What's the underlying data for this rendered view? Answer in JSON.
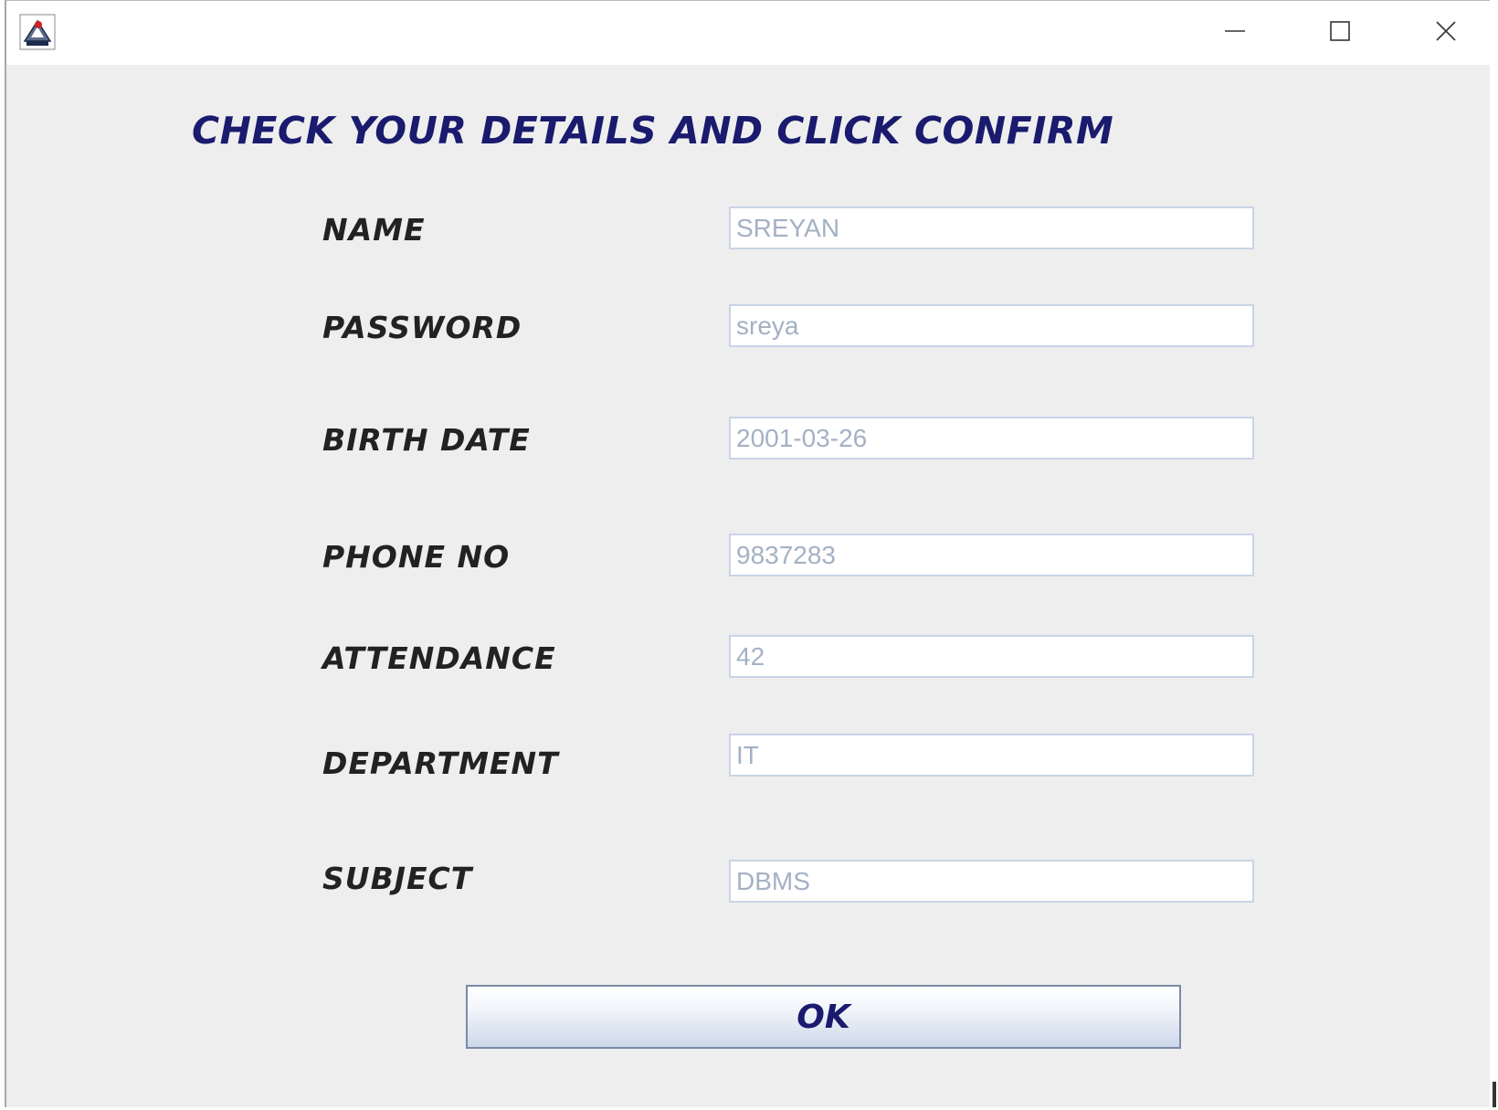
{
  "window": {
    "app_icon": "java-cup-icon",
    "controls": {
      "minimize_icon": "minimize-icon",
      "maximize_icon": "maximize-icon",
      "close_icon": "close-icon"
    }
  },
  "form": {
    "heading": "CHECK YOUR DETAILS AND CLICK CONFIRM",
    "fields": [
      {
        "label": "NAME",
        "value": "SREYAN"
      },
      {
        "label": "PASSWORD",
        "value": "sreya"
      },
      {
        "label": "BIRTH DATE",
        "value": "2001-03-26"
      },
      {
        "label": "PHONE NO",
        "value": "9837283"
      },
      {
        "label": "ATTENDANCE",
        "value": "42"
      },
      {
        "label": "DEPARTMENT",
        "value": "IT"
      },
      {
        "label": "SUBJECT",
        "value": "DBMS"
      }
    ],
    "ok_label": "OK"
  },
  "colors": {
    "heading": "#1a1a6e",
    "label": "#222222",
    "field_text": "#a4b1c4",
    "background": "#eeeeee"
  }
}
